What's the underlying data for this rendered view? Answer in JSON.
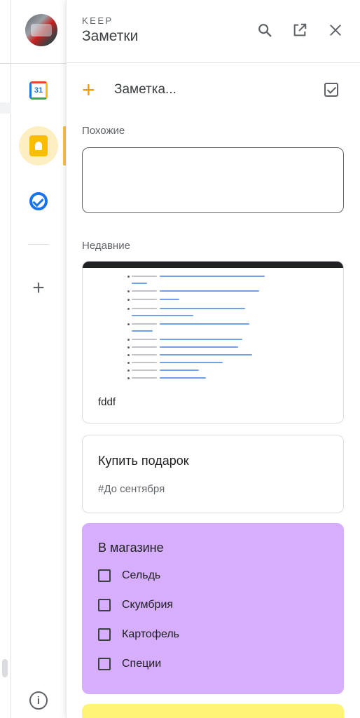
{
  "header": {
    "app_label": "KEEP",
    "title": "Заметки"
  },
  "new_note": {
    "placeholder": "Заметка..."
  },
  "sections": {
    "similar": "Похожие",
    "recent": "Недавние"
  },
  "notes": [
    {
      "type": "image",
      "caption": "fddf"
    },
    {
      "type": "text",
      "title": "Купить подарок",
      "body": "#До сентября"
    },
    {
      "type": "list",
      "title": "В магазине",
      "color": "#d7aefb",
      "items": [
        "Сельдь",
        "Скумбрия",
        "Картофель",
        "Специи"
      ]
    }
  ],
  "side_apps": {
    "calendar_day": "31"
  },
  "colors": {
    "accent": "#f29900",
    "keep_yellow": "#fbbc04",
    "note_purple": "#d7aefb",
    "note_yellow": "#fff475",
    "blue": "#1a73e8"
  }
}
